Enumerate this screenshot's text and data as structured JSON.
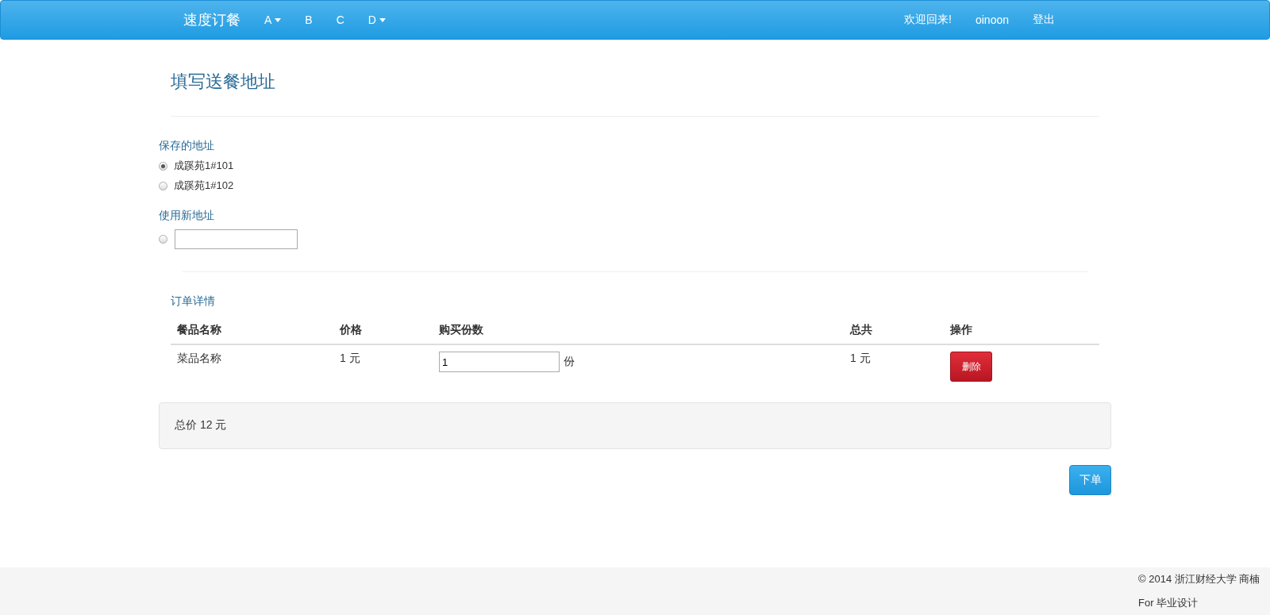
{
  "navbar": {
    "brand": "速度订餐",
    "items": [
      {
        "label": "A",
        "dropdown": true
      },
      {
        "label": "B",
        "dropdown": false
      },
      {
        "label": "C",
        "dropdown": false
      },
      {
        "label": "D",
        "dropdown": true
      }
    ],
    "right": [
      "欢迎回来!",
      "oinoon",
      "登出"
    ]
  },
  "heading": "填写送餐地址",
  "saved_addresses": {
    "label": "保存的地址",
    "options": [
      {
        "label": "成蹊苑1#101",
        "selected": true
      },
      {
        "label": "成蹊苑1#102",
        "selected": false
      }
    ]
  },
  "new_address": {
    "label": "使用新地址",
    "selected": false
  },
  "order": {
    "label": "订单详情",
    "columns": [
      "餐品名称",
      "价格",
      "购买份数",
      "总共",
      "操作"
    ],
    "rows": [
      {
        "name": "菜品名称",
        "price": "1 元",
        "quantity": "1",
        "unit": "份",
        "total": "1 元",
        "action": "删除"
      }
    ]
  },
  "total": "总价 12 元",
  "submit": "下单",
  "footer": [
    "© 2014 浙江财经大学 商楠",
    "For 毕业设计"
  ]
}
